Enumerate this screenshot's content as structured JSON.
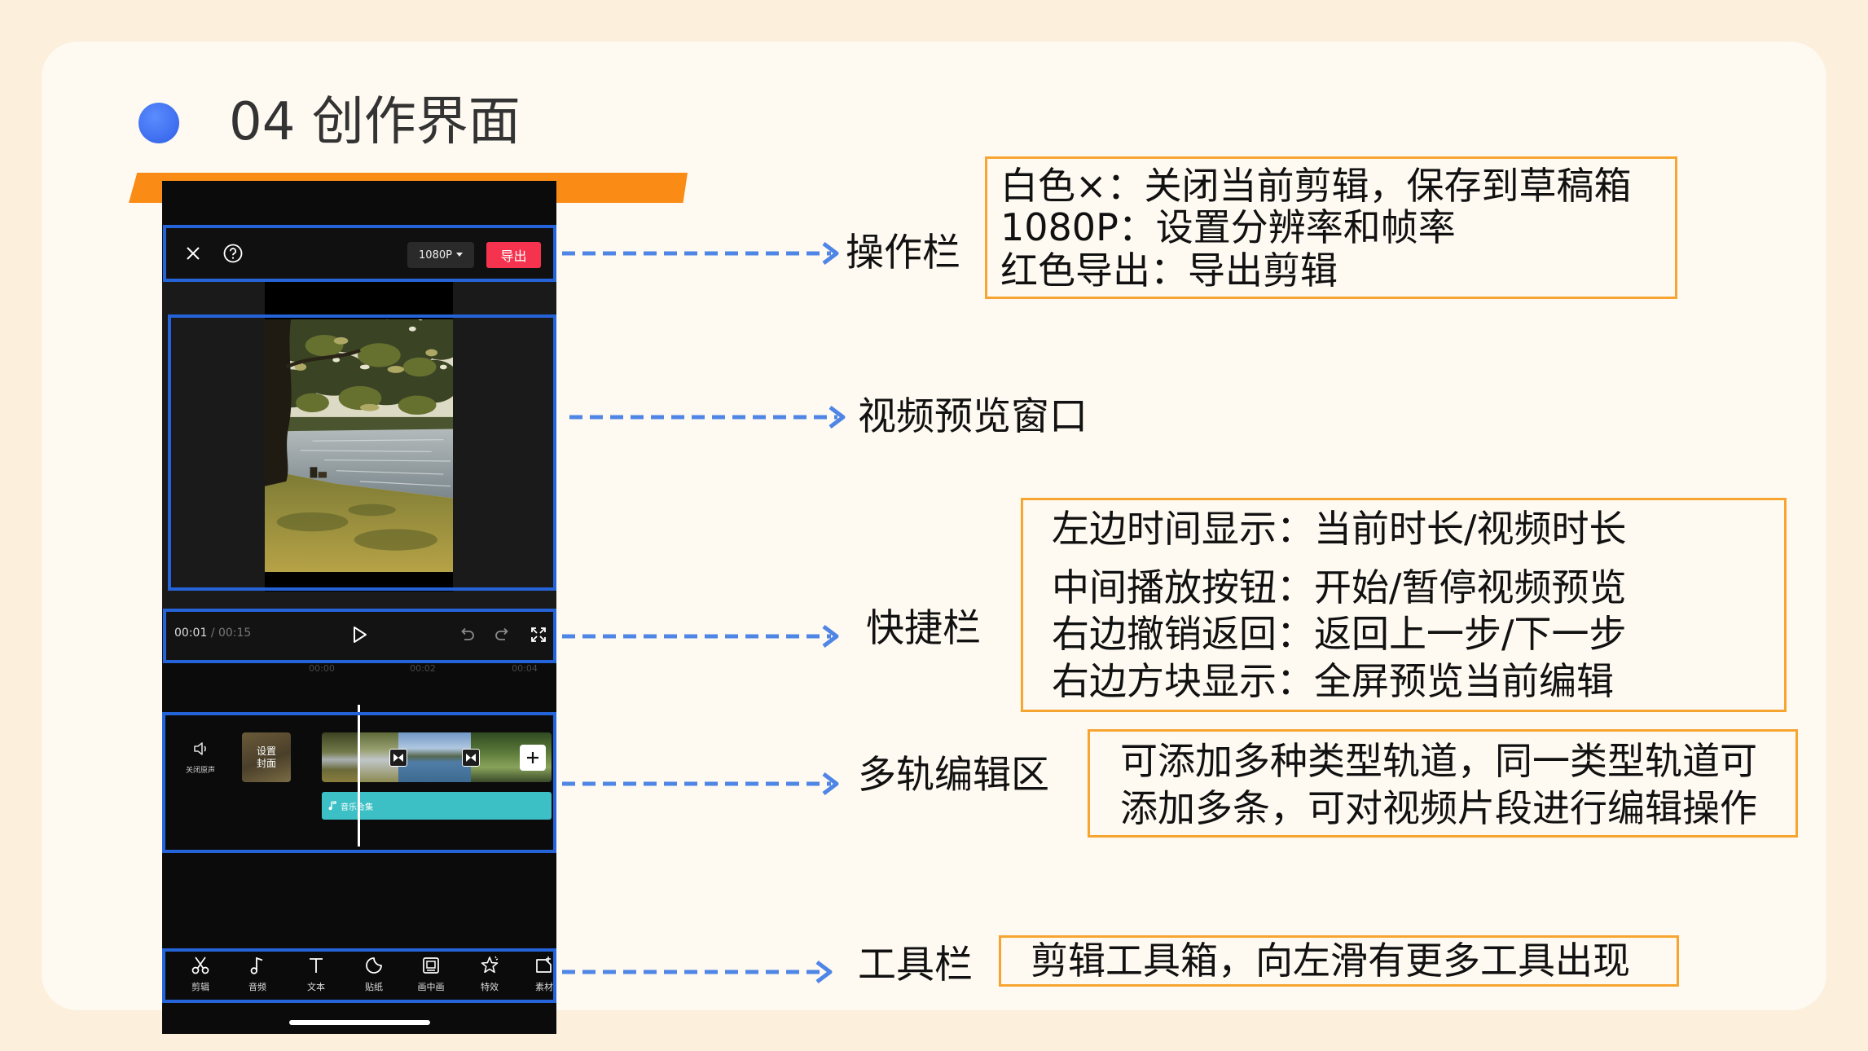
{
  "slide": {
    "title": "04 创作界面",
    "colors": {
      "background": "#FCEFDC",
      "card": "#FEF9F1",
      "title_dot": "#3B6CF2",
      "accent_bar": "#FA8C16",
      "highlight_border": "#2563D9",
      "arrow": "#4F86E6",
      "callout_border": "#F7A531",
      "export_button": "#F5334F",
      "audio_track": "#3CC0C6"
    }
  },
  "phone": {
    "top_bar": {
      "icons": [
        "close-icon",
        "help-icon"
      ],
      "resolution": "1080P",
      "export": "导出"
    },
    "quick_bar": {
      "current_time": "00:01",
      "total_time": "/ 00:15",
      "icons": [
        "play-icon",
        "undo-icon",
        "redo-icon",
        "fullscreen-icon"
      ]
    },
    "ruler": [
      "00:00",
      "00:02",
      "00:04"
    ],
    "tracks": {
      "mute_label": "关闭原声",
      "cover_label": "设置封面",
      "audio_label": "音乐合集"
    },
    "toolbar": [
      {
        "label": "剪辑",
        "icon": "scissors-icon"
      },
      {
        "label": "音频",
        "icon": "music-note-icon"
      },
      {
        "label": "文本",
        "icon": "text-icon"
      },
      {
        "label": "贴纸",
        "icon": "sticker-icon"
      },
      {
        "label": "画中画",
        "icon": "picture-in-picture-icon"
      },
      {
        "label": "特效",
        "icon": "effects-star-icon"
      },
      {
        "label": "素材",
        "icon": "material-icon"
      }
    ]
  },
  "callouts": [
    {
      "label": "操作栏",
      "notes": [
        "白色×：关闭当前剪辑，保存到草稿箱",
        "1080P：设置分辨率和帧率",
        "红色导出：导出剪辑"
      ]
    },
    {
      "label": "视频预览窗口"
    },
    {
      "label": "快捷栏",
      "notes": [
        "左边时间显示：当前时长/视频时长",
        "中间播放按钮：开始/暂停视频预览",
        "右边撤销返回：返回上一步/下一步",
        "右边方块显示：全屏预览当前编辑"
      ]
    },
    {
      "label": "多轨编辑区",
      "notes": [
        "可添加多种类型轨道，同一类型轨道可",
        "添加多条，可对视频片段进行编辑操作"
      ]
    },
    {
      "label": "工具栏",
      "notes": [
        "剪辑工具箱，向左滑有更多工具出现"
      ]
    }
  ]
}
